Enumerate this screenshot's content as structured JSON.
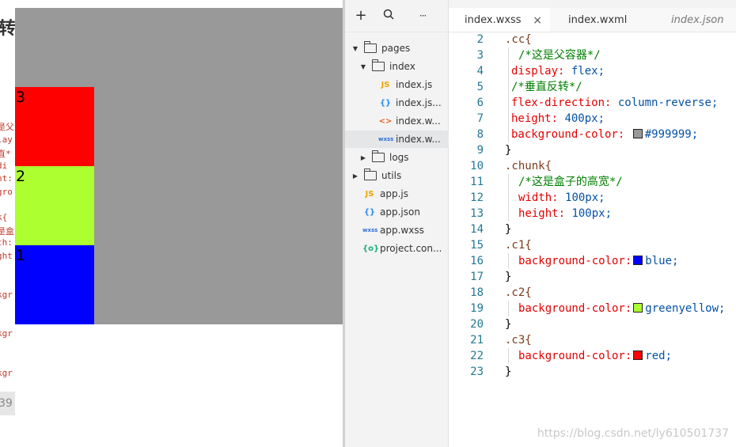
{
  "background": {
    "title_fragment": "转)",
    "code_fragments": [
      "是父",
      "lay",
      "直*",
      "di",
      "nt:",
      "gro",
      "k{",
      "是盒",
      "th:",
      "ght",
      "kgr",
      "kgr",
      "kgr"
    ],
    "number_fragment": "39"
  },
  "simulator": {
    "container_color": "#999999",
    "chunks": [
      {
        "label": "3",
        "color": "red"
      },
      {
        "label": "2",
        "color": "greenyellow"
      },
      {
        "label": "1",
        "color": "blue"
      }
    ]
  },
  "explorer": {
    "toolbar": {
      "add": "+",
      "search": "search-icon",
      "more": "···"
    },
    "items": [
      {
        "name": "pages",
        "type": "folder",
        "expanded": true
      },
      {
        "name": "index",
        "type": "folder",
        "expanded": true
      },
      {
        "name": "index.js",
        "type": "js",
        "icon_text": "JS"
      },
      {
        "name": "index.js...",
        "type": "json",
        "icon_text": "{}"
      },
      {
        "name": "index.w...",
        "type": "wxml",
        "icon_text": "<>"
      },
      {
        "name": "index.w...",
        "type": "wxss",
        "icon_text": "wxss",
        "selected": true
      },
      {
        "name": "logs",
        "type": "folder",
        "expanded": false
      },
      {
        "name": "utils",
        "type": "folder",
        "expanded": false
      },
      {
        "name": "app.js",
        "type": "js",
        "icon_text": "JS"
      },
      {
        "name": "app.json",
        "type": "json",
        "icon_text": "{}"
      },
      {
        "name": "app.wxss",
        "type": "wxss",
        "icon_text": "wxss"
      },
      {
        "name": "project.con...",
        "type": "proj",
        "icon_text": "{o}"
      }
    ]
  },
  "editor": {
    "tabs": [
      {
        "label": "index.wxss",
        "active": true,
        "close": "×"
      },
      {
        "label": "index.wxml",
        "active": false
      },
      {
        "label": "index.json",
        "active": false
      }
    ],
    "line_numbers": [
      "2",
      "3",
      "4",
      "5",
      "6",
      "7",
      "8",
      "9",
      "10",
      "11",
      "12",
      "13",
      "14",
      "15",
      "16",
      "17",
      "18",
      "19",
      "20",
      "21",
      "22",
      "23"
    ],
    "code": {
      "l2_sel": ".cc{",
      "l3_cmt": "/*这是父容器*/",
      "l4_prop": "display:",
      "l4_val": "flex;",
      "l5_cmt": "/*垂直反转*/",
      "l6_prop": "flex-direction:",
      "l6_val": "column-reverse;",
      "l7_prop": "height:",
      "l7_val": "400px;",
      "l8_prop": "background-color:",
      "l8_val": "#999999;",
      "l9": "}",
      "l10_sel": ".chunk{",
      "l11_cmt": "/*这是盒子的高宽*/",
      "l12_prop": "width:",
      "l12_val": "100px;",
      "l13_prop": "height:",
      "l13_val": "100px;",
      "l14": "}",
      "l15_sel": ".c1{",
      "l16_prop": "background-color:",
      "l16_val": "blue;",
      "l17": "}",
      "l18_sel": ".c2{",
      "l19_prop": "background-color:",
      "l19_val": "greenyellow;",
      "l20": "}",
      "l21_sel": ".c3{",
      "l22_prop": "background-color:",
      "l22_val": "red;",
      "l23": "}"
    },
    "swatches": {
      "l8": "#999999",
      "l16": "blue",
      "l19": "greenyellow",
      "l22": "red"
    }
  },
  "watermark": "https://blog.csdn.net/ly610501737"
}
